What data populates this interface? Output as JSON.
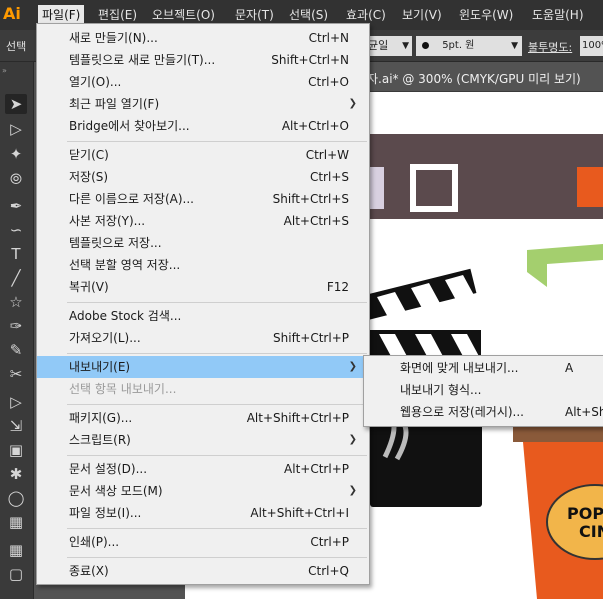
{
  "app": {
    "logo": "Ai"
  },
  "menubar": {
    "items": [
      {
        "label": "파일(F)"
      },
      {
        "label": "편집(E)"
      },
      {
        "label": "오브젝트(O)"
      },
      {
        "label": "문자(T)"
      },
      {
        "label": "선택(S)"
      },
      {
        "label": "효과(C)"
      },
      {
        "label": "보기(V)"
      },
      {
        "label": "윈도우(W)"
      },
      {
        "label": "도움말(H)"
      }
    ]
  },
  "controlbar": {
    "label": "선택",
    "uniform": "균일",
    "brush": "5pt. 원",
    "opacity_label": "불투명도:",
    "opacity_value": "100%"
  },
  "document_tab": {
    "title": "자.ai* @ 300% (CMYK/GPU 미리 보기)"
  },
  "file_menu": {
    "items": [
      {
        "label": "새로 만들기(N)...",
        "shortcut": "Ctrl+N"
      },
      {
        "label": "템플릿으로 새로 만들기(T)...",
        "shortcut": "Shift+Ctrl+N"
      },
      {
        "label": "열기(O)...",
        "shortcut": "Ctrl+O"
      },
      {
        "label": "최근 파일 열기(F)",
        "shortcut": ""
      },
      {
        "label": "Bridge에서 찾아보기...",
        "shortcut": "Alt+Ctrl+O"
      },
      {
        "label": "닫기(C)",
        "shortcut": "Ctrl+W"
      },
      {
        "label": "저장(S)",
        "shortcut": "Ctrl+S"
      },
      {
        "label": "다른 이름으로 저장(A)...",
        "shortcut": "Shift+Ctrl+S"
      },
      {
        "label": "사본 저장(Y)...",
        "shortcut": "Alt+Ctrl+S"
      },
      {
        "label": "템플릿으로 저장...",
        "shortcut": ""
      },
      {
        "label": "선택 분할 영역 저장...",
        "shortcut": ""
      },
      {
        "label": "복귀(V)",
        "shortcut": "F12"
      },
      {
        "label": "Adobe Stock 검색...",
        "shortcut": ""
      },
      {
        "label": "가져오기(L)...",
        "shortcut": "Shift+Ctrl+P"
      },
      {
        "label": "내보내기(E)",
        "shortcut": ""
      },
      {
        "label": "선택 항목 내보내기...",
        "shortcut": ""
      },
      {
        "label": "패키지(G)...",
        "shortcut": "Alt+Shift+Ctrl+P"
      },
      {
        "label": "스크립트(R)",
        "shortcut": ""
      },
      {
        "label": "문서 설정(D)...",
        "shortcut": "Alt+Ctrl+P"
      },
      {
        "label": "문서 색상 모드(M)",
        "shortcut": ""
      },
      {
        "label": "파일 정보(I)...",
        "shortcut": "Alt+Shift+Ctrl+I"
      },
      {
        "label": "인쇄(P)...",
        "shortcut": "Ctrl+P"
      },
      {
        "label": "종료(X)",
        "shortcut": "Ctrl+Q"
      }
    ]
  },
  "export_submenu": {
    "items": [
      {
        "label": "화면에 맞게 내보내기...",
        "shortcut": "A"
      },
      {
        "label": "내보내기 형식...",
        "shortcut": ""
      },
      {
        "label": "웹용으로 저장(레거시)...",
        "shortcut": "Alt+Sh"
      }
    ]
  },
  "artwork": {
    "badge_line1": "POP",
    "badge_line2": "CIN"
  },
  "colors": {
    "highlight": "#91c9f7",
    "menubar": "#323232",
    "logo": "#ff9a00",
    "banner": "#5b4a4d",
    "orange": "#e85a1e",
    "badge": "#f2b54a",
    "green": "#a4cf6e"
  }
}
